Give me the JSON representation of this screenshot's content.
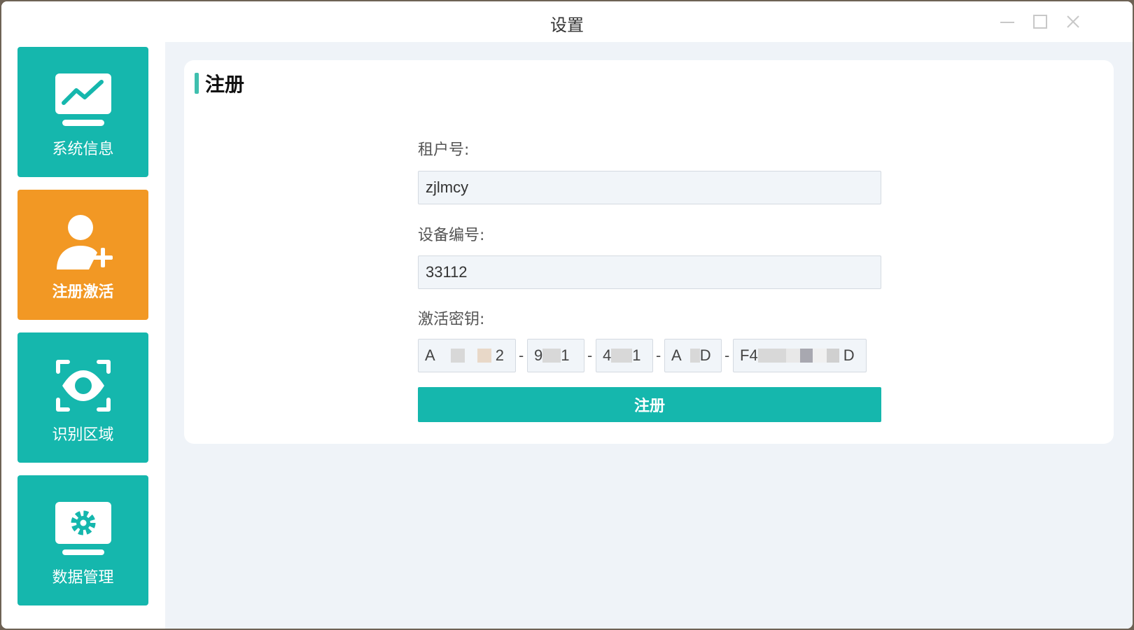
{
  "window": {
    "title": "设置"
  },
  "sidebar": {
    "items": [
      {
        "label": "系统信息",
        "icon": "monitor-chart-icon",
        "active": false
      },
      {
        "label": "注册激活",
        "icon": "user-add-icon",
        "active": true
      },
      {
        "label": "识别区域",
        "icon": "eye-scan-icon",
        "active": false
      },
      {
        "label": "数据管理",
        "icon": "monitor-gear-icon",
        "active": false
      }
    ]
  },
  "card": {
    "title": "注册",
    "tenant": {
      "label": "租户号:",
      "value": "zjlmcy"
    },
    "device": {
      "label": "设备编号:",
      "value": "33112"
    },
    "key": {
      "label": "激活密钥:",
      "segments": [
        {
          "start": "A",
          "end": "2"
        },
        {
          "start": "9",
          "end": "1"
        },
        {
          "start": "4",
          "end": "1"
        },
        {
          "start": "A",
          "end": "D"
        },
        {
          "start": "F4",
          "end": "D"
        }
      ],
      "separator": "-"
    },
    "submit_label": "注册"
  },
  "colors": {
    "teal": "#15b7ad",
    "orange": "#f29824",
    "accent_bar": "#3fbfae",
    "main_bg": "#eff3f8"
  }
}
